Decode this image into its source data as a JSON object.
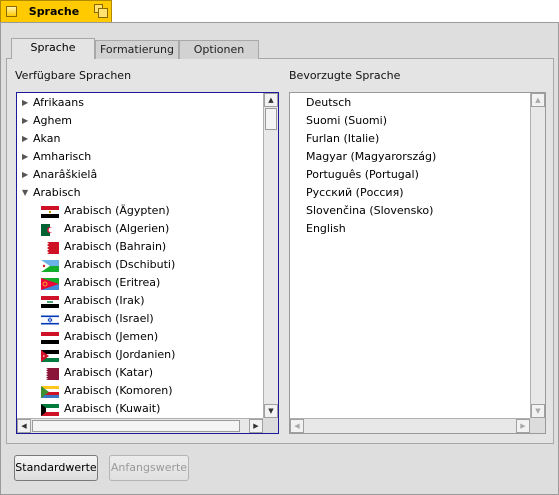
{
  "window": {
    "title": "Sprache"
  },
  "tabs": [
    {
      "label": "Sprache",
      "active": true
    },
    {
      "label": "Formatierung",
      "active": false
    },
    {
      "label": "Optionen",
      "active": false
    }
  ],
  "available": {
    "label": "Verfügbare Sprachen",
    "items": [
      {
        "label": "Afrikaans",
        "expanded": false
      },
      {
        "label": "Aghem",
        "expanded": false
      },
      {
        "label": "Akan",
        "expanded": false
      },
      {
        "label": "Amharisch",
        "expanded": false
      },
      {
        "label": "Anarâškielâ",
        "expanded": false
      },
      {
        "label": "Arabisch",
        "expanded": true
      }
    ],
    "children": [
      {
        "label": "Arabisch (Ägypten)",
        "flag_icon": "egypt-flag-icon"
      },
      {
        "label": "Arabisch (Algerien)",
        "flag_icon": "algeria-flag-icon"
      },
      {
        "label": "Arabisch (Bahrain)",
        "flag_icon": "bahrain-flag-icon"
      },
      {
        "label": "Arabisch (Dschibuti)",
        "flag_icon": "djibouti-flag-icon"
      },
      {
        "label": "Arabisch (Eritrea)",
        "flag_icon": "eritrea-flag-icon"
      },
      {
        "label": "Arabisch (Irak)",
        "flag_icon": "iraq-flag-icon"
      },
      {
        "label": "Arabisch (Israel)",
        "flag_icon": "israel-flag-icon"
      },
      {
        "label": "Arabisch (Jemen)",
        "flag_icon": "yemen-flag-icon"
      },
      {
        "label": "Arabisch (Jordanien)",
        "flag_icon": "jordan-flag-icon"
      },
      {
        "label": "Arabisch (Katar)",
        "flag_icon": "qatar-flag-icon"
      },
      {
        "label": "Arabisch (Komoren)",
        "flag_icon": "comoros-flag-icon"
      },
      {
        "label": "Arabisch (Kuwait)",
        "flag_icon": "kuwait-flag-icon"
      }
    ]
  },
  "preferred": {
    "label": "Bevorzugte Sprache",
    "items": [
      "Deutsch",
      "Suomi (Suomi)",
      "Furlan (Italie)",
      "Magyar (Magyarország)",
      "Português (Portugal)",
      "Русский (Россия)",
      "Slovenčina (Slovensko)",
      "English"
    ]
  },
  "buttons": {
    "defaults": "Standardwerte",
    "revert": "Anfangswerte"
  },
  "colors": {
    "window_tab": "#ffcb00",
    "focus_border": "#1a1a9a",
    "panel": "#dedede"
  }
}
